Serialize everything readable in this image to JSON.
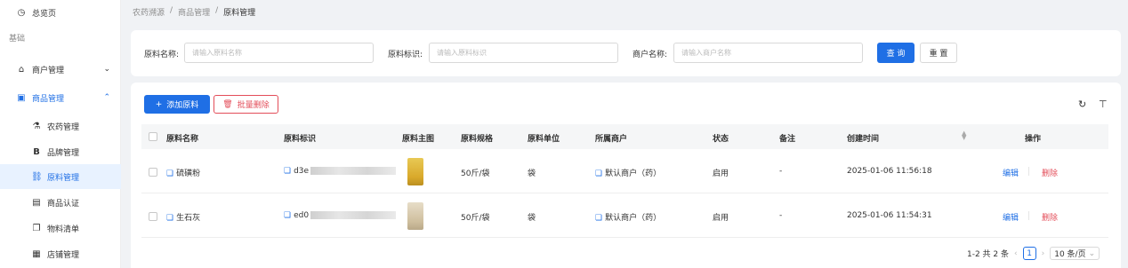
{
  "sidebar": {
    "overview": {
      "label": "总览页",
      "icon": "dashboard-icon"
    },
    "group_label": "基础",
    "items": [
      {
        "label": "商户管理",
        "icon": "bank-icon",
        "expanded": false
      },
      {
        "label": "商品管理",
        "icon": "picture-icon",
        "expanded": true
      }
    ],
    "sub_items": [
      {
        "label": "农药管理",
        "icon": "flask-icon"
      },
      {
        "label": "品牌管理",
        "icon": "brand-b-icon"
      },
      {
        "label": "原料管理",
        "icon": "link-icon",
        "active": true
      },
      {
        "label": "商品认证",
        "icon": "certificate-icon"
      },
      {
        "label": "物料清单",
        "icon": "copy-doc-icon"
      },
      {
        "label": "店铺管理",
        "icon": "store-icon"
      }
    ]
  },
  "breadcrumb": [
    "农药溯源",
    "商品管理",
    "原料管理"
  ],
  "search": {
    "name_label": "原料名称:",
    "name_placeholder": "请输入原料名称",
    "code_label": "原料标识:",
    "code_placeholder": "请输入原料标识",
    "merchant_label": "商户名称:",
    "merchant_placeholder": "请输入商户名称",
    "query_label": "查 询",
    "reset_label": "重 置"
  },
  "toolbar": {
    "add_label": "添加原料",
    "batch_delete_label": "批量删除"
  },
  "table": {
    "headers": [
      "原料名称",
      "原料标识",
      "原料主图",
      "原料规格",
      "原料单位",
      "所属商户",
      "状态",
      "备注",
      "创建时间",
      "操作"
    ],
    "rows": [
      {
        "name": "硫磺粉",
        "code": "d3e",
        "spec": "50斤/袋",
        "unit": "袋",
        "merchant": "默认商户（药）",
        "status": "启用",
        "note": "-",
        "created": "2025-01-06 11:56:18",
        "image": "yellow"
      },
      {
        "name": "生石灰",
        "code": "ed0",
        "spec": "50斤/袋",
        "unit": "袋",
        "merchant": "默认商户（药）",
        "status": "启用",
        "note": "-",
        "created": "2025-01-06 11:54:31",
        "image": "beige"
      }
    ],
    "edit_label": "编辑",
    "delete_label": "删除"
  },
  "pagination": {
    "summary": "1-2 共 2 条",
    "current_page": "1",
    "page_size": "10 条/页"
  },
  "colors": {
    "primary": "#1f6fe5",
    "danger": "#e34d59",
    "active_bg": "#e8f2ff"
  }
}
